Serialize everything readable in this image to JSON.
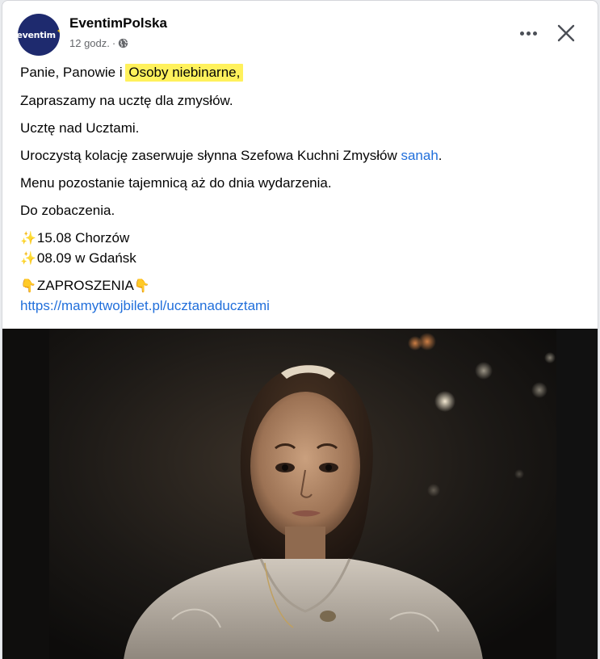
{
  "post": {
    "page_name": "EventimPolska",
    "avatar_text": "eventim",
    "time": "12 godz.",
    "time_separator": "·",
    "privacy_icon": "globe-icon",
    "more_icon": "more-horizontal-icon",
    "close_icon": "close-icon"
  },
  "content": {
    "line1_prefix": "Panie, Panowie i ",
    "line1_highlight": "Osoby niebinarne,",
    "line2": "Zapraszamy na ucztę dla zmysłów.",
    "line3": "Ucztę nad Ucztami.",
    "line4_prefix": "Uroczystą kolację zaserwuje słynna Szefowa Kuchni Zmysłów ",
    "line4_link": "sanah",
    "line4_suffix": ".",
    "line5": "Menu pozostanie tajemnicą aż do dnia wydarzenia.",
    "line6": "Do zobaczenia.",
    "date1_emoji": "✨",
    "date1": "15.08 Chorzów",
    "date2_emoji": "✨",
    "date2": "08.09 w Gdańsk",
    "invite_emoji_left": "👇",
    "invite_label": "ZAPROSZENIA",
    "invite_emoji_right": "👇",
    "ticket_link": "https://mamytwojbilet.pl/ucztanaducztami"
  },
  "colors": {
    "highlight": "#fff15c",
    "link": "#216fdb",
    "avatar_bg": "#1e2a6e",
    "text": "#050505",
    "meta": "#65676b"
  }
}
